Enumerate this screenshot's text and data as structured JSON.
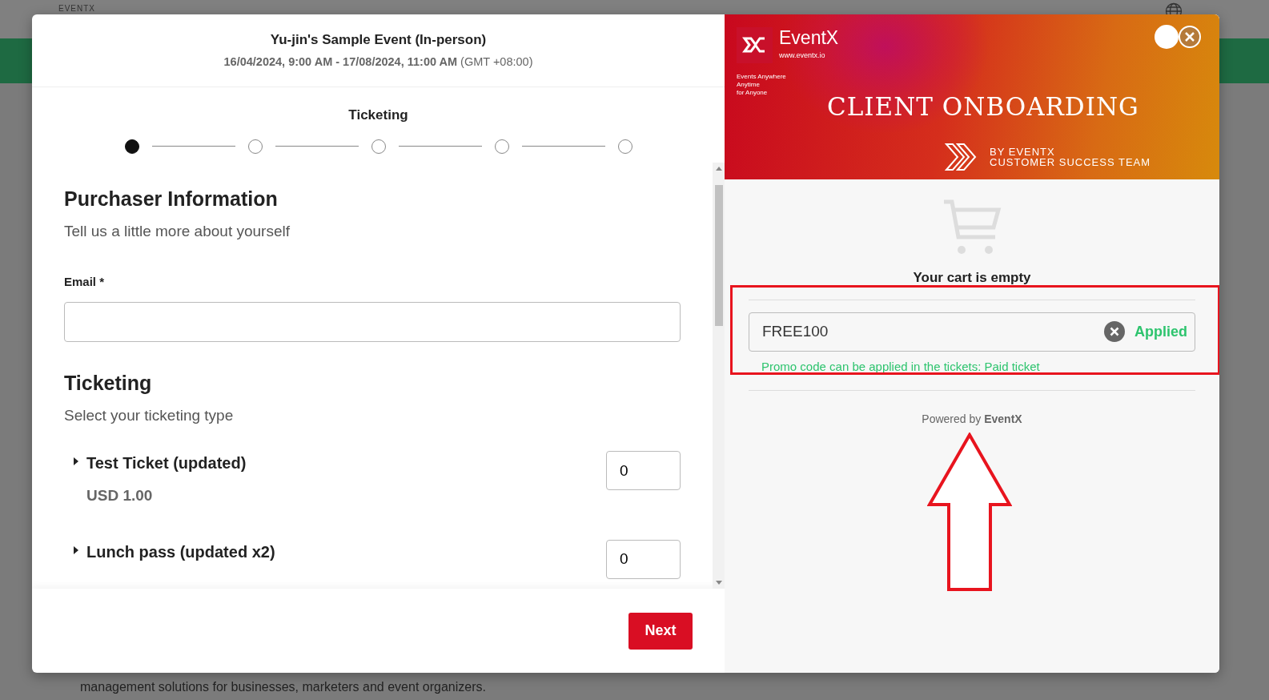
{
  "backdrop": {
    "logo": "EVENTX",
    "text": "management solutions for businesses, marketers and event organizers."
  },
  "event": {
    "title": "Yu-jin's Sample Event (In-person)",
    "dates": "**16/04/2024, 9:00 AM - 17/08/2024, 11:00 AM** (GMT +08:00)"
  },
  "stepper": {
    "title": "Ticketing",
    "steps": [
      {
        "selected": true
      },
      {
        "selected": false
      },
      {
        "selected": false
      },
      {
        "selected": false
      },
      {
        "selected": false
      }
    ]
  },
  "purchaser": {
    "heading": "Purchaser Information",
    "subtitle": "Tell us a little more about yourself",
    "email_label": "Email *"
  },
  "ticketing": {
    "heading": "Ticketing",
    "subtitle": "Select your ticketing type",
    "tickets": [
      {
        "name": "Test Ticket (updated)",
        "price": "USD 1.00",
        "quantity": "0",
        "expanded": false
      },
      {
        "name": "Lunch pass (updated x2)",
        "quantity": "0",
        "expanded": false
      }
    ]
  },
  "next_button": "Next",
  "banner": {
    "brand": "EventX",
    "url": "www.eventx.io",
    "tagline": [
      "Events Anywhere",
      "Anytime",
      "for Anyone"
    ],
    "title": "CLIENT ONBOARDING",
    "byline": [
      "BY EVENTX",
      "CUSTOMER SUCCESS TEAM"
    ]
  },
  "cart": {
    "empty_text": "Your cart is empty",
    "promo": {
      "value": "FREE100",
      "status": "Applied",
      "message": "Promo code can be applied in the tickets: Paid ticket"
    },
    "powered_by": "Powered by **EventX**"
  }
}
